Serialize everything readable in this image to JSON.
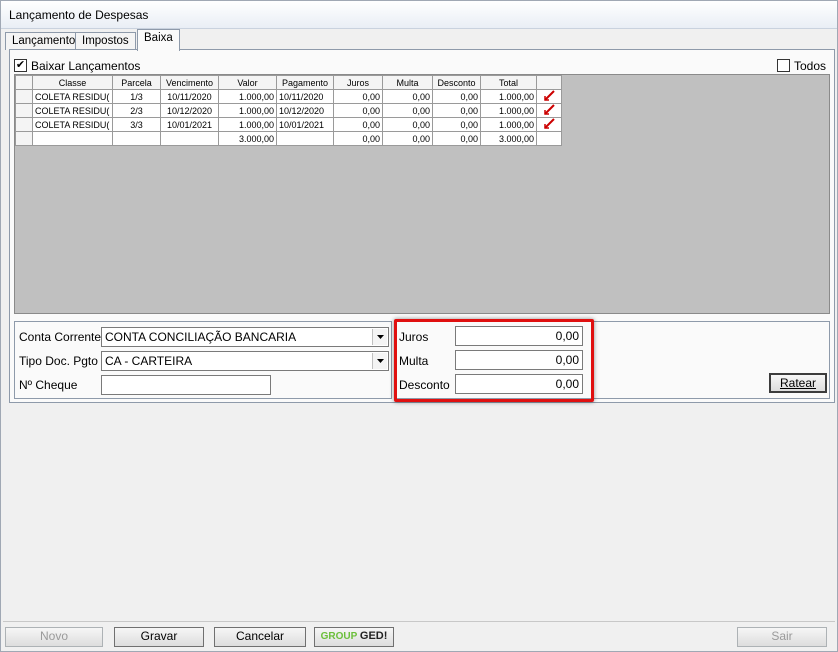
{
  "window": {
    "title": "Lançamento de Despesas"
  },
  "tabs": [
    {
      "label": "Lançamento"
    },
    {
      "label": "Impostos"
    },
    {
      "label": "Baixa"
    }
  ],
  "baixa": {
    "baixar_lancamentos_label": "Baixar Lançamentos",
    "baixar_lancamentos_checked": true,
    "todos_label": "Todos",
    "todos_checked": false,
    "grid": {
      "columns": [
        "Classe",
        "Parcela",
        "Vencimento",
        "Valor",
        "Pagamento",
        "Juros",
        "Multa",
        "Desconto",
        "Total"
      ],
      "rows": [
        {
          "classe": "COLETA RESIDU(",
          "parcela": "1/3",
          "vencimento": "10/11/2020",
          "valor": "1.000,00",
          "pagamento": "10/11/2020",
          "juros": "0,00",
          "multa": "0,00",
          "desconto": "0,00",
          "total": "1.000,00"
        },
        {
          "classe": "COLETA RESIDU(",
          "parcela": "2/3",
          "vencimento": "10/12/2020",
          "valor": "1.000,00",
          "pagamento": "10/12/2020",
          "juros": "0,00",
          "multa": "0,00",
          "desconto": "0,00",
          "total": "1.000,00"
        },
        {
          "classe": "COLETA RESIDU(",
          "parcela": "3/3",
          "vencimento": "10/01/2021",
          "valor": "1.000,00",
          "pagamento": "10/01/2021",
          "juros": "0,00",
          "multa": "0,00",
          "desconto": "0,00",
          "total": "1.000,00"
        }
      ],
      "totals": {
        "valor": "3.000,00",
        "juros": "0,00",
        "multa": "0,00",
        "desconto": "0,00",
        "total": "3.000,00"
      }
    },
    "form": {
      "conta_corrente_label": "Conta Corrente",
      "conta_corrente_value": "CONTA CONCILIAÇÃO BANCARIA",
      "tipo_doc_label": "Tipo Doc. Pgto",
      "tipo_doc_value": "CA - CARTEIRA",
      "cheque_label": "Nº Cheque",
      "cheque_value": "",
      "juros_label": "Juros",
      "juros_value": "0,00",
      "multa_label": "Multa",
      "multa_value": "0,00",
      "desconto_label": "Desconto",
      "desconto_value": "0,00",
      "ratear_label": "Ratear"
    }
  },
  "buttons": {
    "novo": "Novo",
    "gravar": "Gravar",
    "cancelar": "Cancelar",
    "group_ged_a": "GROUP",
    "group_ged_b": "GED!",
    "sair": "Sair"
  },
  "colors": {
    "highlight_border": "#e01010",
    "grid_background": "#c0c0c0",
    "ged_green": "#6bbf3a"
  }
}
